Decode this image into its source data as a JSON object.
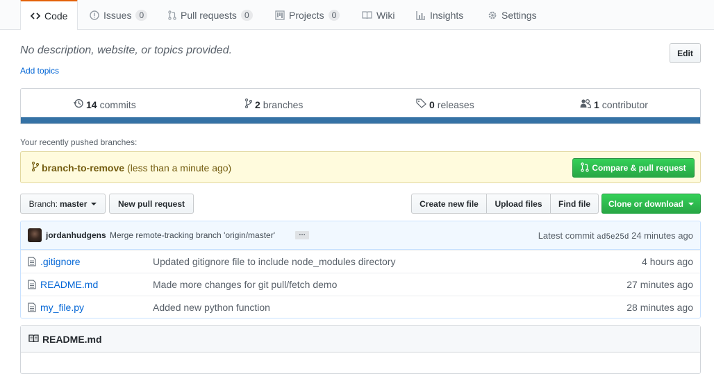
{
  "tabs": [
    {
      "label": "Code",
      "icon": "code-icon"
    },
    {
      "label": "Issues",
      "count": "0",
      "icon": "issue-icon"
    },
    {
      "label": "Pull requests",
      "count": "0",
      "icon": "pull-request-icon"
    },
    {
      "label": "Projects",
      "count": "0",
      "icon": "project-icon"
    },
    {
      "label": "Wiki",
      "icon": "book-icon"
    },
    {
      "label": "Insights",
      "icon": "graph-icon"
    },
    {
      "label": "Settings",
      "icon": "gear-icon"
    }
  ],
  "repo": {
    "description": "No description, website, or topics provided.",
    "add_topics": "Add topics",
    "edit_label": "Edit"
  },
  "summary": {
    "commits_count": "14",
    "commits_label": "commits",
    "branches_count": "2",
    "branches_label": "branches",
    "releases_count": "0",
    "releases_label": "releases",
    "contributors_count": "1",
    "contributors_label": "contributor",
    "language_color": "#3572a5"
  },
  "recent": {
    "label": "Your recently pushed branches:",
    "branch": "branch-to-remove",
    "time": "(less than a minute ago)",
    "compare_label": "Compare & pull request"
  },
  "filenav": {
    "branch_prefix": "Branch:",
    "branch_name": "master",
    "new_pr": "New pull request",
    "create_file": "Create new file",
    "upload_files": "Upload files",
    "find_file": "Find file",
    "clone": "Clone or download"
  },
  "commit": {
    "author": "jordanhudgens",
    "message": "Merge remote-tracking branch 'origin/master'",
    "ellipsis": "…",
    "latest_label": "Latest commit",
    "sha": "ad5e25d",
    "age": "24 minutes ago"
  },
  "files": [
    {
      "name": ".gitignore",
      "message": "Updated gitignore file to include node_modules directory",
      "age": "4 hours ago"
    },
    {
      "name": "README.md",
      "message": "Made more changes for git pull/fetch demo",
      "age": "27 minutes ago"
    },
    {
      "name": "my_file.py",
      "message": "Added new python function",
      "age": "28 minutes ago"
    }
  ],
  "readme": {
    "title": "README.md"
  },
  "colors": {
    "accent_tab": "#e36209",
    "link": "#0366d6",
    "green": "#28a745"
  }
}
